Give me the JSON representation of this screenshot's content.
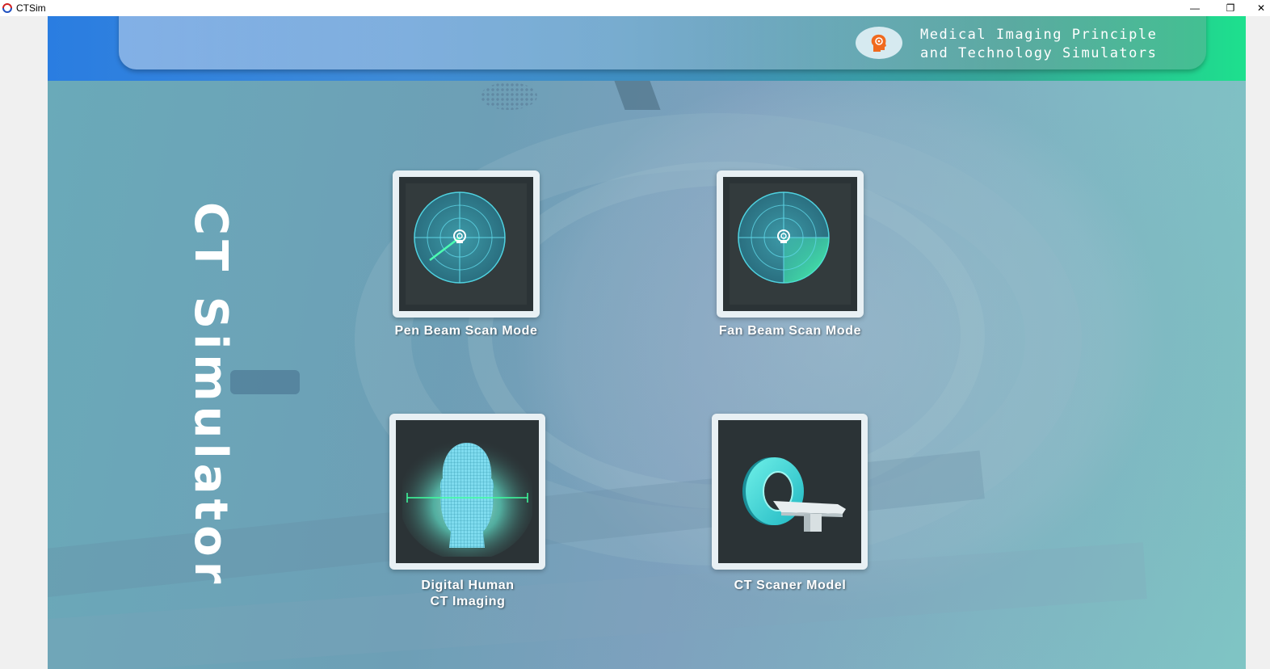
{
  "window": {
    "title": "CTSim",
    "minimize_glyph": "—",
    "restore_glyph": "❐",
    "close_glyph": "✕"
  },
  "header": {
    "title_line1": "Medical Imaging Principle",
    "title_line2": "and Technology Simulators",
    "logo_icon": "head-gear-icon"
  },
  "side_title": "CT Simulator",
  "modes": [
    {
      "label": "Pen Beam Scan Mode",
      "icon": "pen-beam-radar-icon"
    },
    {
      "label": "Fan Beam Scan  Mode",
      "icon": "fan-beam-radar-icon"
    },
    {
      "label_line1": "Digital Human",
      "label_line2": "CT Imaging",
      "icon": "digital-head-scan-icon"
    },
    {
      "label": "CT Scaner Model",
      "icon": "ct-scanner-icon"
    }
  ],
  "colors": {
    "header_gradient_start": "#2a7de1",
    "header_gradient_end": "#1de08e",
    "tile_border": "#e8f0f4",
    "radar_accent": "#3fe0c8"
  }
}
